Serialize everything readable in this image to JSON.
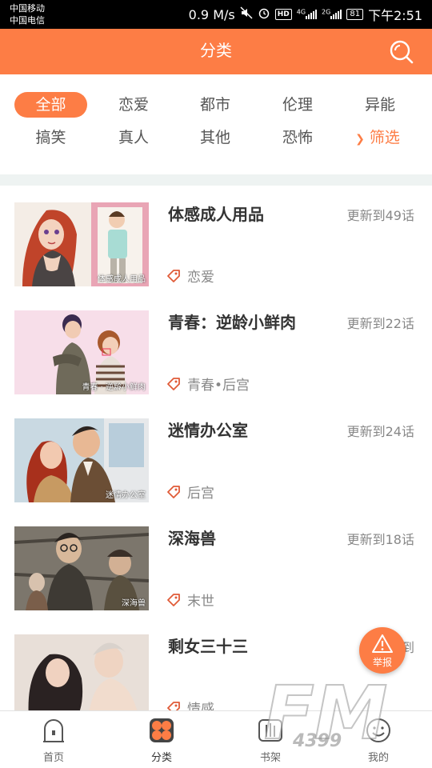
{
  "status_bar": {
    "carrier_1": "中国移动",
    "carrier_2": "中国电信",
    "speed": "0.9 M/s",
    "hd": "HD",
    "signal_1_label": "4G",
    "signal_2_label": "2G",
    "battery": "81",
    "time": "下午2:51"
  },
  "header": {
    "title": "分类",
    "search_icon": "search-icon",
    "background_color": "#fd7d45"
  },
  "filters": {
    "row1": [
      "全部",
      "恋爱",
      "都市",
      "伦理",
      "异能"
    ],
    "row2": [
      "搞笑",
      "真人",
      "其他",
      "恐怖"
    ],
    "filter_button": "筛选",
    "active": "全部"
  },
  "comics": [
    {
      "title": "体感成人用品",
      "update": "更新到49话",
      "tag": "恋爱",
      "cover_caption": "体感成人用品"
    },
    {
      "title": "青春：逆龄小鲜肉",
      "update": "更新到22话",
      "tag": "青春•后宫",
      "cover_caption": "青春 · 逆龄小鲜肉"
    },
    {
      "title": "迷情办公室",
      "update": "更新到24话",
      "tag": "后宫",
      "cover_caption": "迷情办公室"
    },
    {
      "title": "深海兽",
      "update": "更新到18话",
      "tag": "末世",
      "cover_caption": "深海兽"
    },
    {
      "title": "剩女三十三",
      "update": "更新到",
      "tag": "情感",
      "cover_caption": ""
    }
  ],
  "report_button": {
    "label": "举报",
    "icon": "warning-icon"
  },
  "bottom_nav": [
    {
      "label": "首页",
      "icon": "home-icon"
    },
    {
      "label": "分类",
      "icon": "category-icon",
      "active": true
    },
    {
      "label": "书架",
      "icon": "bookshelf-icon"
    },
    {
      "label": "我的",
      "icon": "profile-icon"
    }
  ],
  "watermark": {
    "brand": "FM",
    "number": "4399"
  },
  "colors": {
    "accent": "#fd7d45",
    "text": "#333333",
    "muted": "#888888"
  }
}
